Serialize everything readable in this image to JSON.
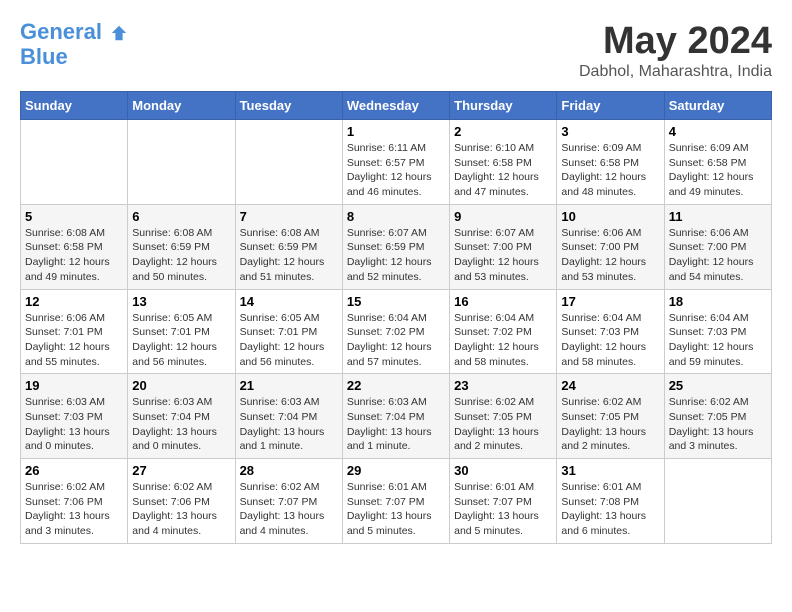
{
  "header": {
    "logo_line1": "General",
    "logo_line2": "Blue",
    "month_title": "May 2024",
    "location": "Dabhol, Maharashtra, India"
  },
  "days_of_week": [
    "Sunday",
    "Monday",
    "Tuesday",
    "Wednesday",
    "Thursday",
    "Friday",
    "Saturday"
  ],
  "weeks": [
    [
      {
        "day": "",
        "info": ""
      },
      {
        "day": "",
        "info": ""
      },
      {
        "day": "",
        "info": ""
      },
      {
        "day": "1",
        "info": "Sunrise: 6:11 AM\nSunset: 6:57 PM\nDaylight: 12 hours\nand 46 minutes."
      },
      {
        "day": "2",
        "info": "Sunrise: 6:10 AM\nSunset: 6:58 PM\nDaylight: 12 hours\nand 47 minutes."
      },
      {
        "day": "3",
        "info": "Sunrise: 6:09 AM\nSunset: 6:58 PM\nDaylight: 12 hours\nand 48 minutes."
      },
      {
        "day": "4",
        "info": "Sunrise: 6:09 AM\nSunset: 6:58 PM\nDaylight: 12 hours\nand 49 minutes."
      }
    ],
    [
      {
        "day": "5",
        "info": "Sunrise: 6:08 AM\nSunset: 6:58 PM\nDaylight: 12 hours\nand 49 minutes."
      },
      {
        "day": "6",
        "info": "Sunrise: 6:08 AM\nSunset: 6:59 PM\nDaylight: 12 hours\nand 50 minutes."
      },
      {
        "day": "7",
        "info": "Sunrise: 6:08 AM\nSunset: 6:59 PM\nDaylight: 12 hours\nand 51 minutes."
      },
      {
        "day": "8",
        "info": "Sunrise: 6:07 AM\nSunset: 6:59 PM\nDaylight: 12 hours\nand 52 minutes."
      },
      {
        "day": "9",
        "info": "Sunrise: 6:07 AM\nSunset: 7:00 PM\nDaylight: 12 hours\nand 53 minutes."
      },
      {
        "day": "10",
        "info": "Sunrise: 6:06 AM\nSunset: 7:00 PM\nDaylight: 12 hours\nand 53 minutes."
      },
      {
        "day": "11",
        "info": "Sunrise: 6:06 AM\nSunset: 7:00 PM\nDaylight: 12 hours\nand 54 minutes."
      }
    ],
    [
      {
        "day": "12",
        "info": "Sunrise: 6:06 AM\nSunset: 7:01 PM\nDaylight: 12 hours\nand 55 minutes."
      },
      {
        "day": "13",
        "info": "Sunrise: 6:05 AM\nSunset: 7:01 PM\nDaylight: 12 hours\nand 56 minutes."
      },
      {
        "day": "14",
        "info": "Sunrise: 6:05 AM\nSunset: 7:01 PM\nDaylight: 12 hours\nand 56 minutes."
      },
      {
        "day": "15",
        "info": "Sunrise: 6:04 AM\nSunset: 7:02 PM\nDaylight: 12 hours\nand 57 minutes."
      },
      {
        "day": "16",
        "info": "Sunrise: 6:04 AM\nSunset: 7:02 PM\nDaylight: 12 hours\nand 58 minutes."
      },
      {
        "day": "17",
        "info": "Sunrise: 6:04 AM\nSunset: 7:03 PM\nDaylight: 12 hours\nand 58 minutes."
      },
      {
        "day": "18",
        "info": "Sunrise: 6:04 AM\nSunset: 7:03 PM\nDaylight: 12 hours\nand 59 minutes."
      }
    ],
    [
      {
        "day": "19",
        "info": "Sunrise: 6:03 AM\nSunset: 7:03 PM\nDaylight: 13 hours\nand 0 minutes."
      },
      {
        "day": "20",
        "info": "Sunrise: 6:03 AM\nSunset: 7:04 PM\nDaylight: 13 hours\nand 0 minutes."
      },
      {
        "day": "21",
        "info": "Sunrise: 6:03 AM\nSunset: 7:04 PM\nDaylight: 13 hours\nand 1 minute."
      },
      {
        "day": "22",
        "info": "Sunrise: 6:03 AM\nSunset: 7:04 PM\nDaylight: 13 hours\nand 1 minute."
      },
      {
        "day": "23",
        "info": "Sunrise: 6:02 AM\nSunset: 7:05 PM\nDaylight: 13 hours\nand 2 minutes."
      },
      {
        "day": "24",
        "info": "Sunrise: 6:02 AM\nSunset: 7:05 PM\nDaylight: 13 hours\nand 2 minutes."
      },
      {
        "day": "25",
        "info": "Sunrise: 6:02 AM\nSunset: 7:05 PM\nDaylight: 13 hours\nand 3 minutes."
      }
    ],
    [
      {
        "day": "26",
        "info": "Sunrise: 6:02 AM\nSunset: 7:06 PM\nDaylight: 13 hours\nand 3 minutes."
      },
      {
        "day": "27",
        "info": "Sunrise: 6:02 AM\nSunset: 7:06 PM\nDaylight: 13 hours\nand 4 minutes."
      },
      {
        "day": "28",
        "info": "Sunrise: 6:02 AM\nSunset: 7:07 PM\nDaylight: 13 hours\nand 4 minutes."
      },
      {
        "day": "29",
        "info": "Sunrise: 6:01 AM\nSunset: 7:07 PM\nDaylight: 13 hours\nand 5 minutes."
      },
      {
        "day": "30",
        "info": "Sunrise: 6:01 AM\nSunset: 7:07 PM\nDaylight: 13 hours\nand 5 minutes."
      },
      {
        "day": "31",
        "info": "Sunrise: 6:01 AM\nSunset: 7:08 PM\nDaylight: 13 hours\nand 6 minutes."
      },
      {
        "day": "",
        "info": ""
      }
    ]
  ]
}
